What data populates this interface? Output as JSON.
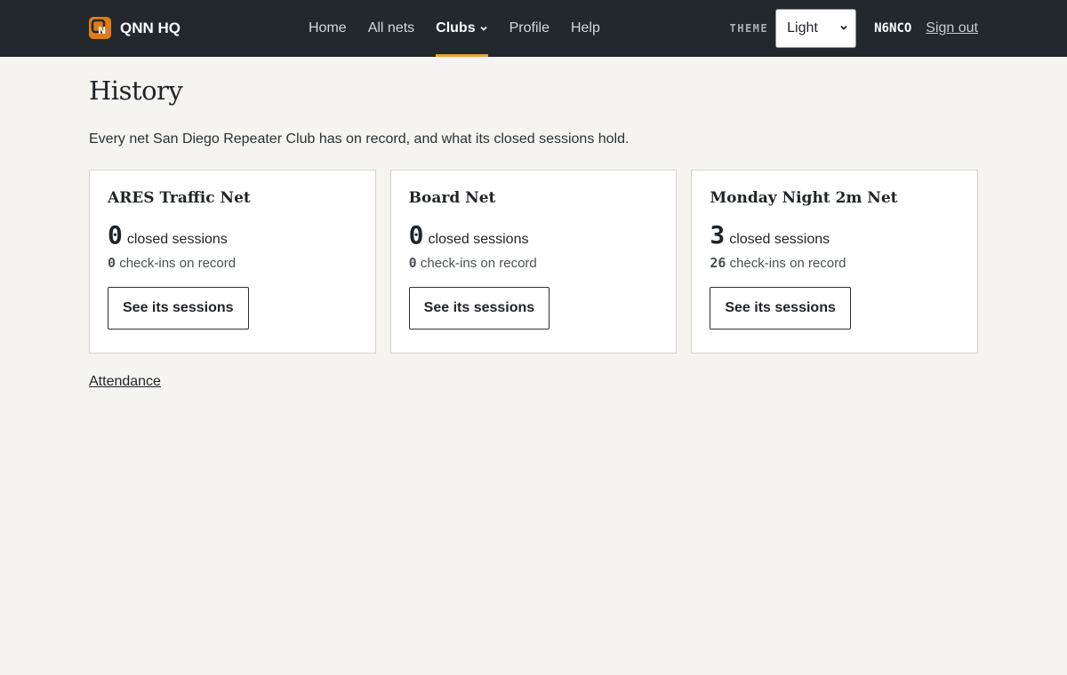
{
  "header": {
    "brand": "QNN HQ",
    "nav": [
      {
        "label": "Home"
      },
      {
        "label": "All nets"
      },
      {
        "label": "Clubs"
      },
      {
        "label": "Profile"
      },
      {
        "label": "Help"
      }
    ],
    "active_nav": "Clubs",
    "theme_label": "THEME",
    "theme_value": "Light",
    "callsign": "N6NCO",
    "sign_out": "Sign out",
    "accent_color": "#e8a23a"
  },
  "page": {
    "title": "History",
    "intro": "Every net San Diego Repeater Club has on record, and what its closed sessions hold.",
    "closed_label": "closed sessions",
    "checkins_label": "check-ins on record",
    "button_label": "See its sessions",
    "nets": [
      {
        "name": "ARES Traffic Net",
        "closed_sessions": "0",
        "checkins": "0"
      },
      {
        "name": "Board Net",
        "closed_sessions": "0",
        "checkins": "0"
      },
      {
        "name": "Monday Night 2m Net",
        "closed_sessions": "3",
        "checkins": "26"
      }
    ],
    "attendance_link": "Attendance"
  }
}
